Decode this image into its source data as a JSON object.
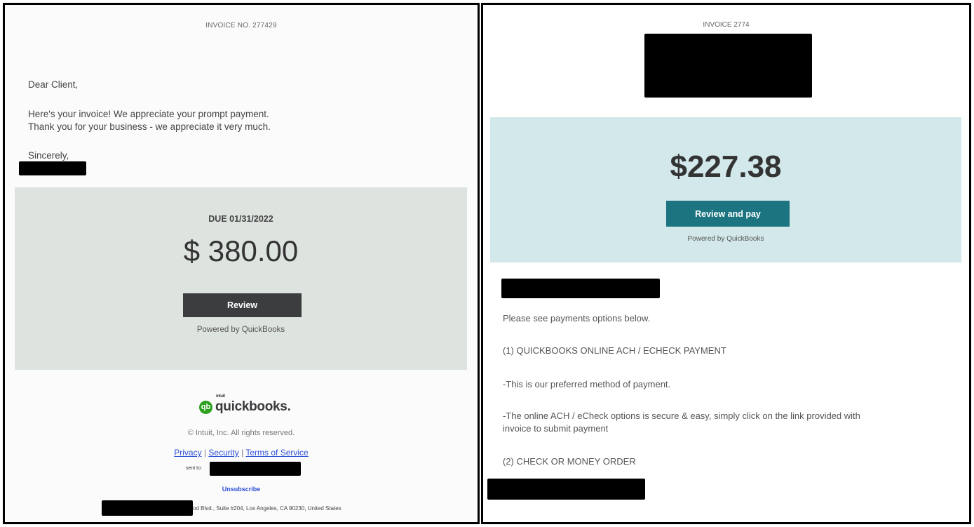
{
  "left": {
    "invoice_no": "INVOICE NO. 277429",
    "greeting": "Dear Client,",
    "message_line1": "Here's your invoice! We appreciate your prompt payment.",
    "message_line2": "Thank you for your business - we appreciate it very much.",
    "signoff": "Sincerely,",
    "due": "DUE 01/31/2022",
    "amount": "$ 380.00",
    "review_button": "Review",
    "powered_by": "Powered by QuickBooks",
    "logo_intuit": "intuit",
    "logo_word": "quickbooks.",
    "logo_icon": "qb",
    "copyright": "© Intuit, Inc. All rights reserved.",
    "links": {
      "privacy": "Privacy",
      "security": "Security",
      "terms": "Terms of Service",
      "sep": "|"
    },
    "sent_to": "sent to:",
    "unsubscribe": "Unsubscribe",
    "address": "od Blvd., Suite #204, Los Angeles, CA 90230, United States"
  },
  "right": {
    "invoice_no": "INVOICE 2774",
    "amount": "$227.38",
    "review_button": "Review and pay",
    "powered_by": "Powered by QuickBooks",
    "line1": "Please see payments options below.",
    "line2": "(1) QUICKBOOKS ONLINE ACH / ECHECK PAYMENT",
    "line3": "-This is our preferred method of payment.",
    "line4a": "-The online ACH / eCheck options is secure & easy, simply click on the link provided with",
    "line4b": "invoice to submit payment",
    "line5": "(2) CHECK OR MONEY ORDER"
  },
  "colors": {
    "left_payment_box": "#dde3df",
    "right_payment_box": "#d3e8ea",
    "review_button": "#3c3d3f",
    "review_pay_button": "#1b7480",
    "link": "#2b4fd6",
    "quickbooks_green": "#2ca01c",
    "redaction": "#000000"
  }
}
